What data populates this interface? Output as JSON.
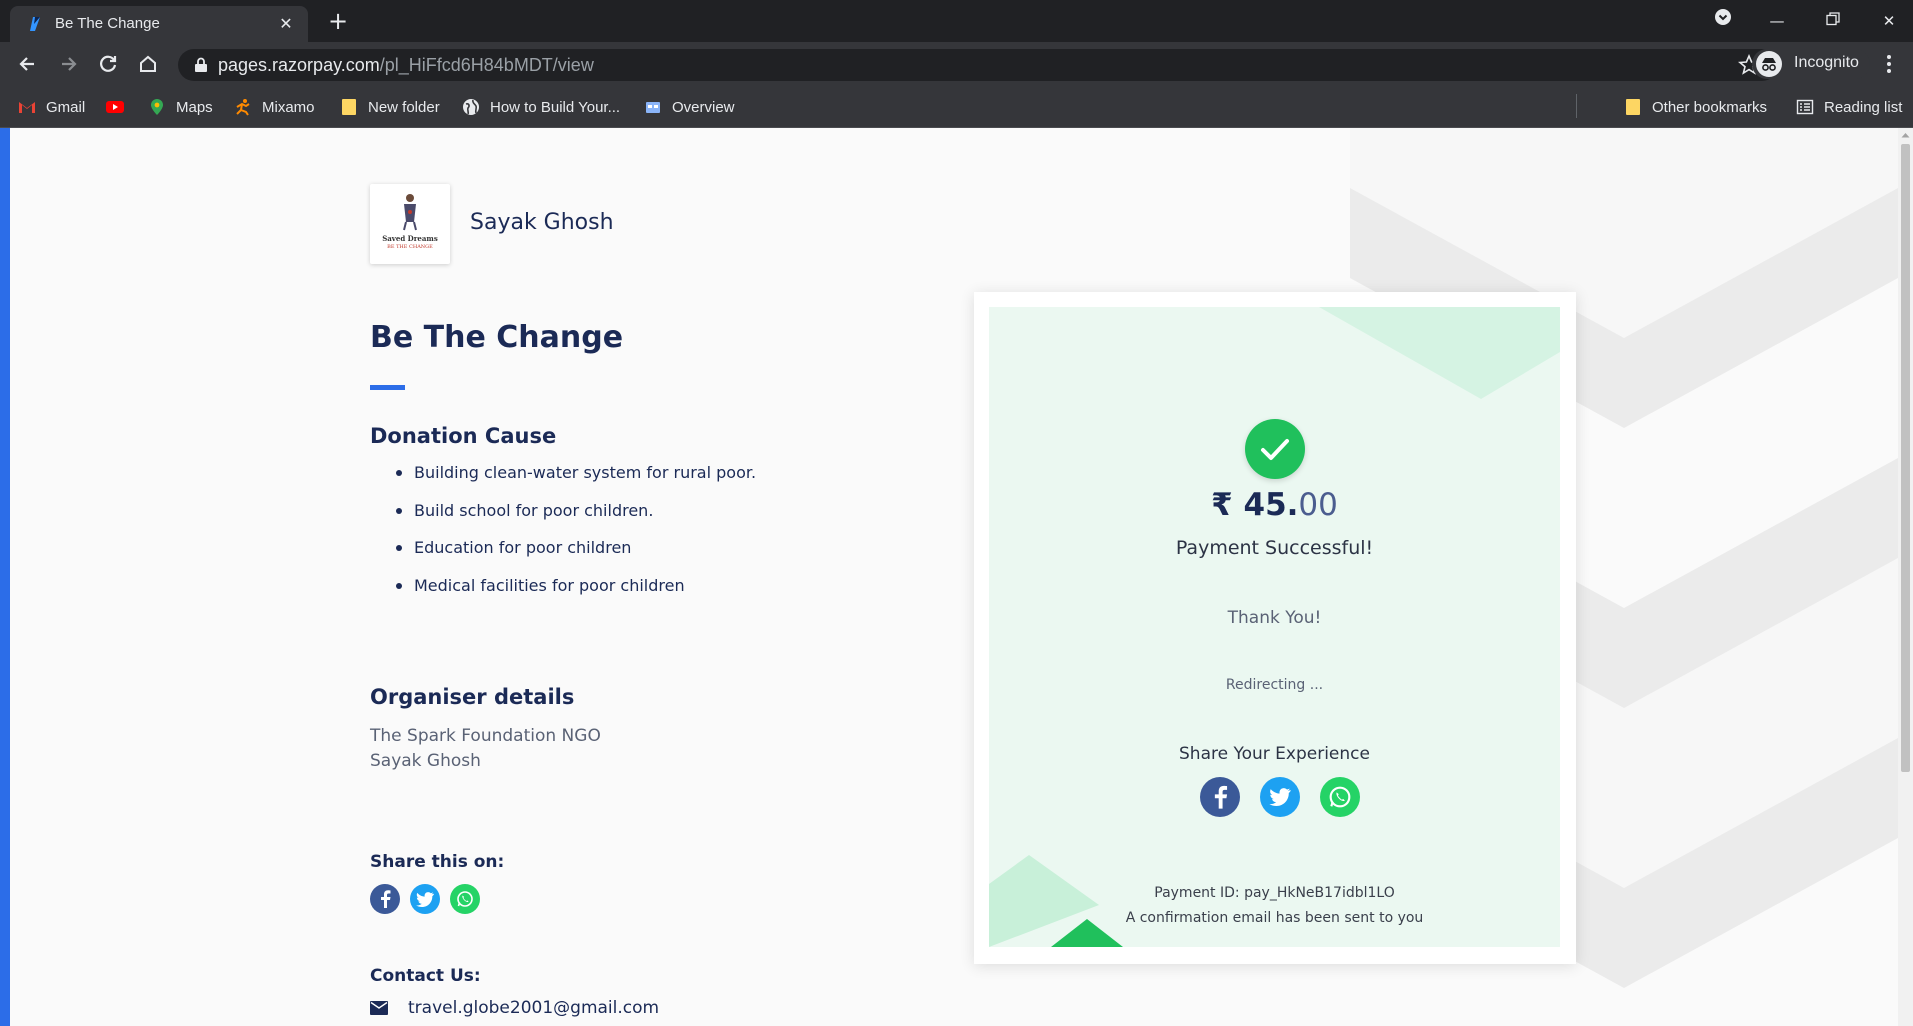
{
  "browser": {
    "tab_title": "Be The Change",
    "url_host": "pages.razorpay.com",
    "url_path": "/pl_HiFfcd6H84bMDT/view",
    "profile_label": "Incognito",
    "bookmarks": [
      {
        "label": "Gmail",
        "icon": "gmail-icon"
      },
      {
        "label": "",
        "icon": "youtube-icon"
      },
      {
        "label": "Maps",
        "icon": "maps-icon"
      },
      {
        "label": "Mixamo",
        "icon": "mixamo-icon"
      },
      {
        "label": "New folder",
        "icon": "folder-icon"
      },
      {
        "label": "How to Build Your...",
        "icon": "globe-icon"
      },
      {
        "label": "Overview",
        "icon": "overview-icon"
      }
    ],
    "other_bookmarks": "Other bookmarks",
    "reading_list": "Reading list"
  },
  "page": {
    "logo_text_top": "Saved Dreams",
    "logo_text_bottom": "BE THE CHANGE",
    "merchant_name": "Sayak Ghosh",
    "title": "Be The Change",
    "donation_heading": "Donation Cause",
    "causes": [
      "Building clean-water system for rural poor.",
      "Build school for poor children.",
      "Education for poor children",
      "Medical facilities for poor children"
    ],
    "organiser_heading": "Organiser details",
    "organiser_lines": [
      "The Spark Foundation NGO",
      "Sayak Ghosh"
    ],
    "share_heading": "Share this on:",
    "contact_heading": "Contact Us:",
    "contact_email": "travel.globe2001@gmail.com"
  },
  "success_card": {
    "currency": "₹",
    "amount_whole": "45.",
    "amount_decimal": "00",
    "status": "Payment Successful!",
    "thanks": "Thank You!",
    "redirecting": "Redirecting ...",
    "share_label": "Share Your Experience",
    "payment_id": "Payment ID: pay_HkNeB17idbl1LO",
    "confirmation": "A confirmation email has been sent to you"
  },
  "colors": {
    "brand_blue": "#2c6de8",
    "navy": "#1b2a56",
    "success_green": "#20c05c",
    "card_bg": "#ebf8f1",
    "facebook": "#3b5998",
    "twitter": "#1da1f2",
    "whatsapp": "#25d366"
  }
}
